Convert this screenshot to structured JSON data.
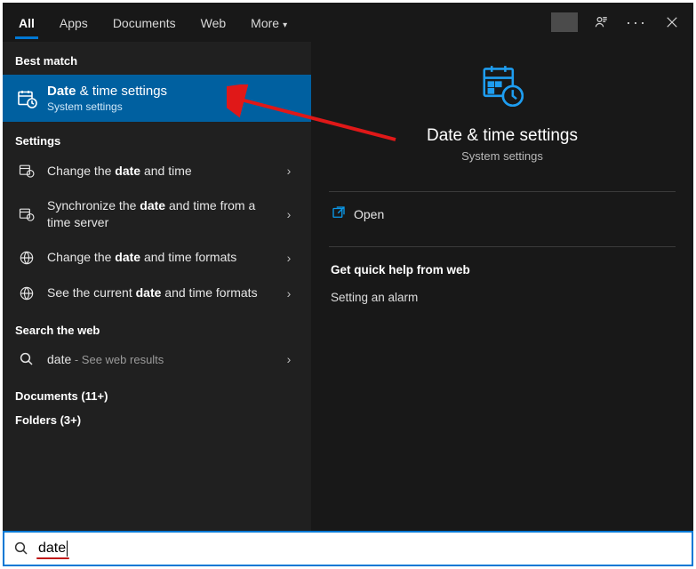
{
  "tabs": {
    "all": "All",
    "apps": "Apps",
    "documents": "Documents",
    "web": "Web",
    "more": "More"
  },
  "sections": {
    "bestmatch": "Best match",
    "settings": "Settings",
    "searchweb": "Search the web",
    "documents": "Documents (11+)",
    "folders": "Folders (3+)"
  },
  "best": {
    "title_prefix": "Date",
    "title_rest": " & time settings",
    "sub": "System settings"
  },
  "settings_items": [
    {
      "pre": "Change the ",
      "bold": "date",
      "post": " and time"
    },
    {
      "pre": "Synchronize the ",
      "bold": "date",
      "post": " and time from a time server"
    },
    {
      "pre": "Change the ",
      "bold": "date",
      "post": " and time formats"
    },
    {
      "pre": "See the current ",
      "bold": "date",
      "post": " and time formats"
    }
  ],
  "web": {
    "term": "date",
    "hint": " - See web results"
  },
  "preview": {
    "title": "Date & time settings",
    "sub": "System settings",
    "open": "Open",
    "help_title": "Get quick help from web",
    "help_items": [
      "Setting an alarm"
    ]
  },
  "query": "date"
}
